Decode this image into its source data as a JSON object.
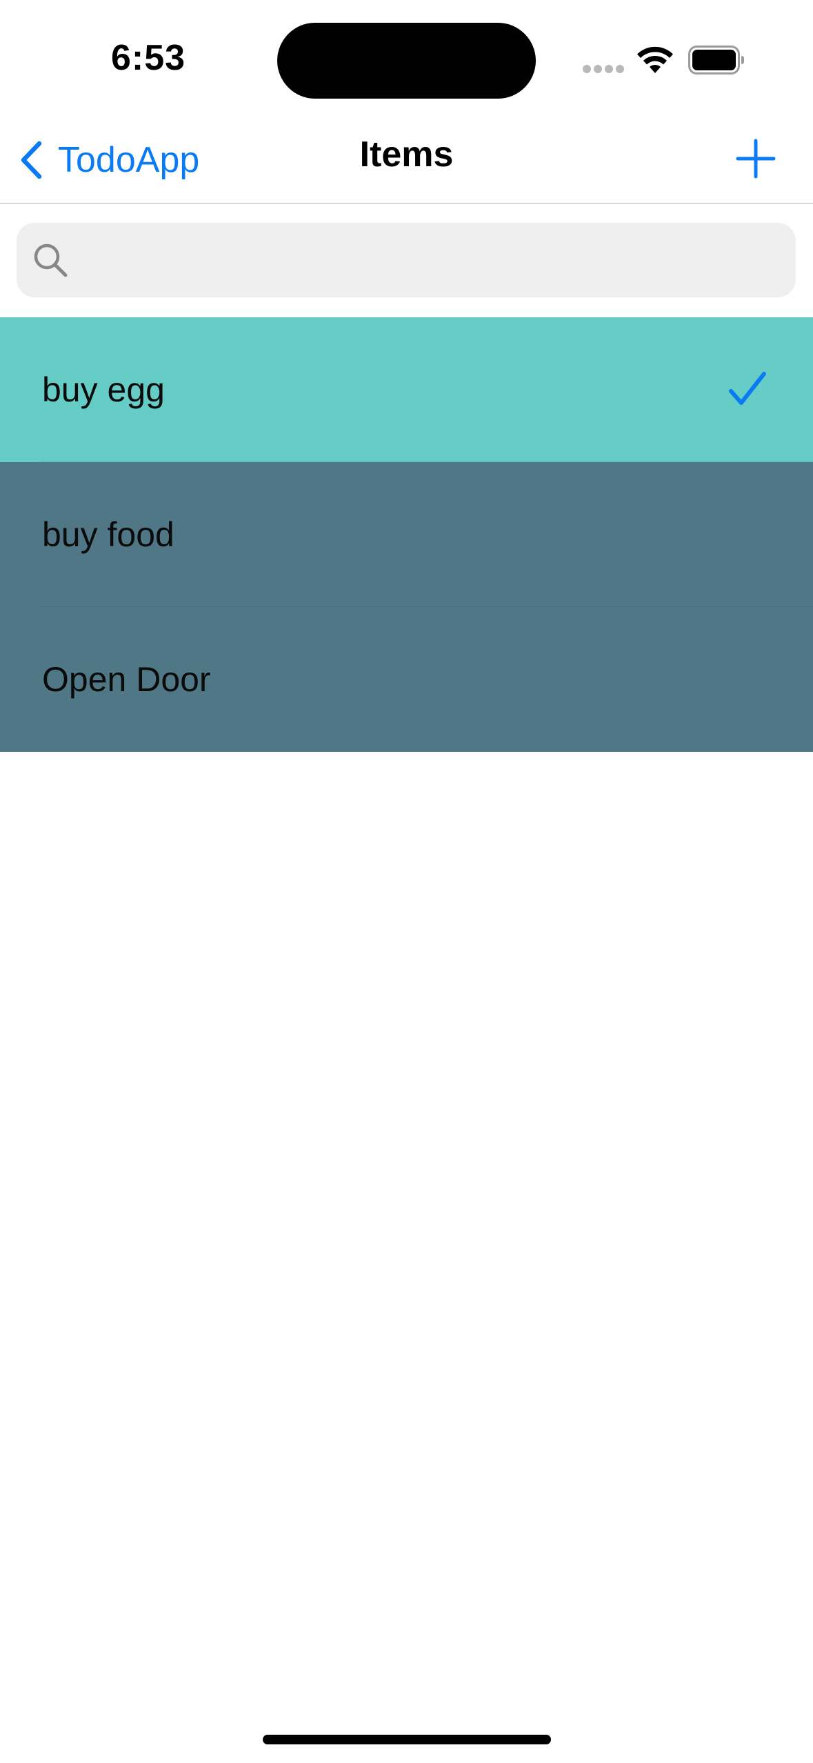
{
  "status_bar": {
    "time": "6:53"
  },
  "nav": {
    "back_label": "TodoApp",
    "title": "Items",
    "add_icon": "plus-icon"
  },
  "search": {
    "value": "",
    "placeholder": "",
    "icon": "magnifying-glass-icon"
  },
  "items": [
    {
      "title": "buy egg",
      "done": true,
      "background": "#66ccc6"
    },
    {
      "title": "buy food",
      "done": false,
      "background": "#507785"
    },
    {
      "title": "Open Door",
      "done": false,
      "background": "#507785"
    }
  ],
  "colors": {
    "accent": "#0a7bf3",
    "completed_row": "#66ccc6",
    "pending_row": "#507785",
    "divider": "#4a6f7c"
  }
}
